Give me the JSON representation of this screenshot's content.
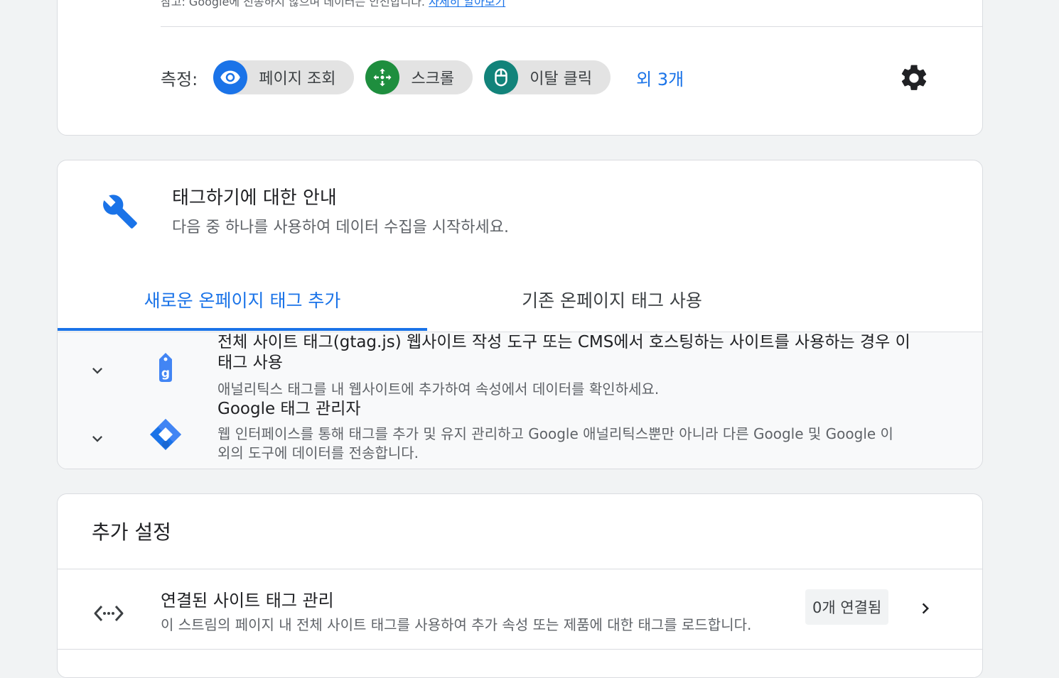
{
  "measurement_card": {
    "partial_text": "참고: Google에 전송하지 않으며 데이터는 안전합니다.",
    "partial_link": "자세히 알아보기",
    "label": "측정:",
    "chips": [
      {
        "label": "페이지 조회",
        "icon": "eye-icon",
        "color": "#1a73e8"
      },
      {
        "label": "스크롤",
        "icon": "scroll-arrows-icon",
        "color": "#1e8e3e"
      },
      {
        "label": "이탈 클릭",
        "icon": "mouse-icon",
        "color": "#12837a"
      }
    ],
    "more_link": "외 3개",
    "settings_icon": "gear-icon"
  },
  "tagging_card": {
    "icon": "wrench-icon",
    "title": "태그하기에 대한 안내",
    "subtitle": "다음 중 하나를 사용하여 데이터 수집을 시작하세요.",
    "tabs": [
      {
        "label": "새로운 온페이지 태그 추가",
        "active": true
      },
      {
        "label": "기존 온페이지 태그 사용",
        "active": false
      }
    ],
    "items": [
      {
        "title": "전체 사이트 태그(gtag.js) 웹사이트 작성 도구 또는 CMS에서 호스팅하는 사이트를 사용하는 경우 이 태그 사용",
        "description": "애널리틱스 태그를 내 웹사이트에 추가하여 속성에서 데이터를 확인하세요.",
        "icon": "gtag-icon"
      },
      {
        "title": "Google 태그 관리자",
        "description": "웹 인터페이스를 통해 태그를 추가 및 유지 관리하고 Google 애널리틱스뿐만 아니라 다른 Google 및 Google 이외의 도구에 데이터를 전송합니다.",
        "icon": "tag-manager-icon"
      }
    ]
  },
  "additional_card": {
    "title": "추가 설정",
    "rows": [
      {
        "icon": "code-icon",
        "title": "연결된 사이트 태그 관리",
        "description": "이 스트림의 페이지 내 전체 사이트 태그를 사용하여 추가 속성 또는 제품에 대한 태그를 로드합니다.",
        "badge": "0개 연결됨"
      }
    ]
  }
}
